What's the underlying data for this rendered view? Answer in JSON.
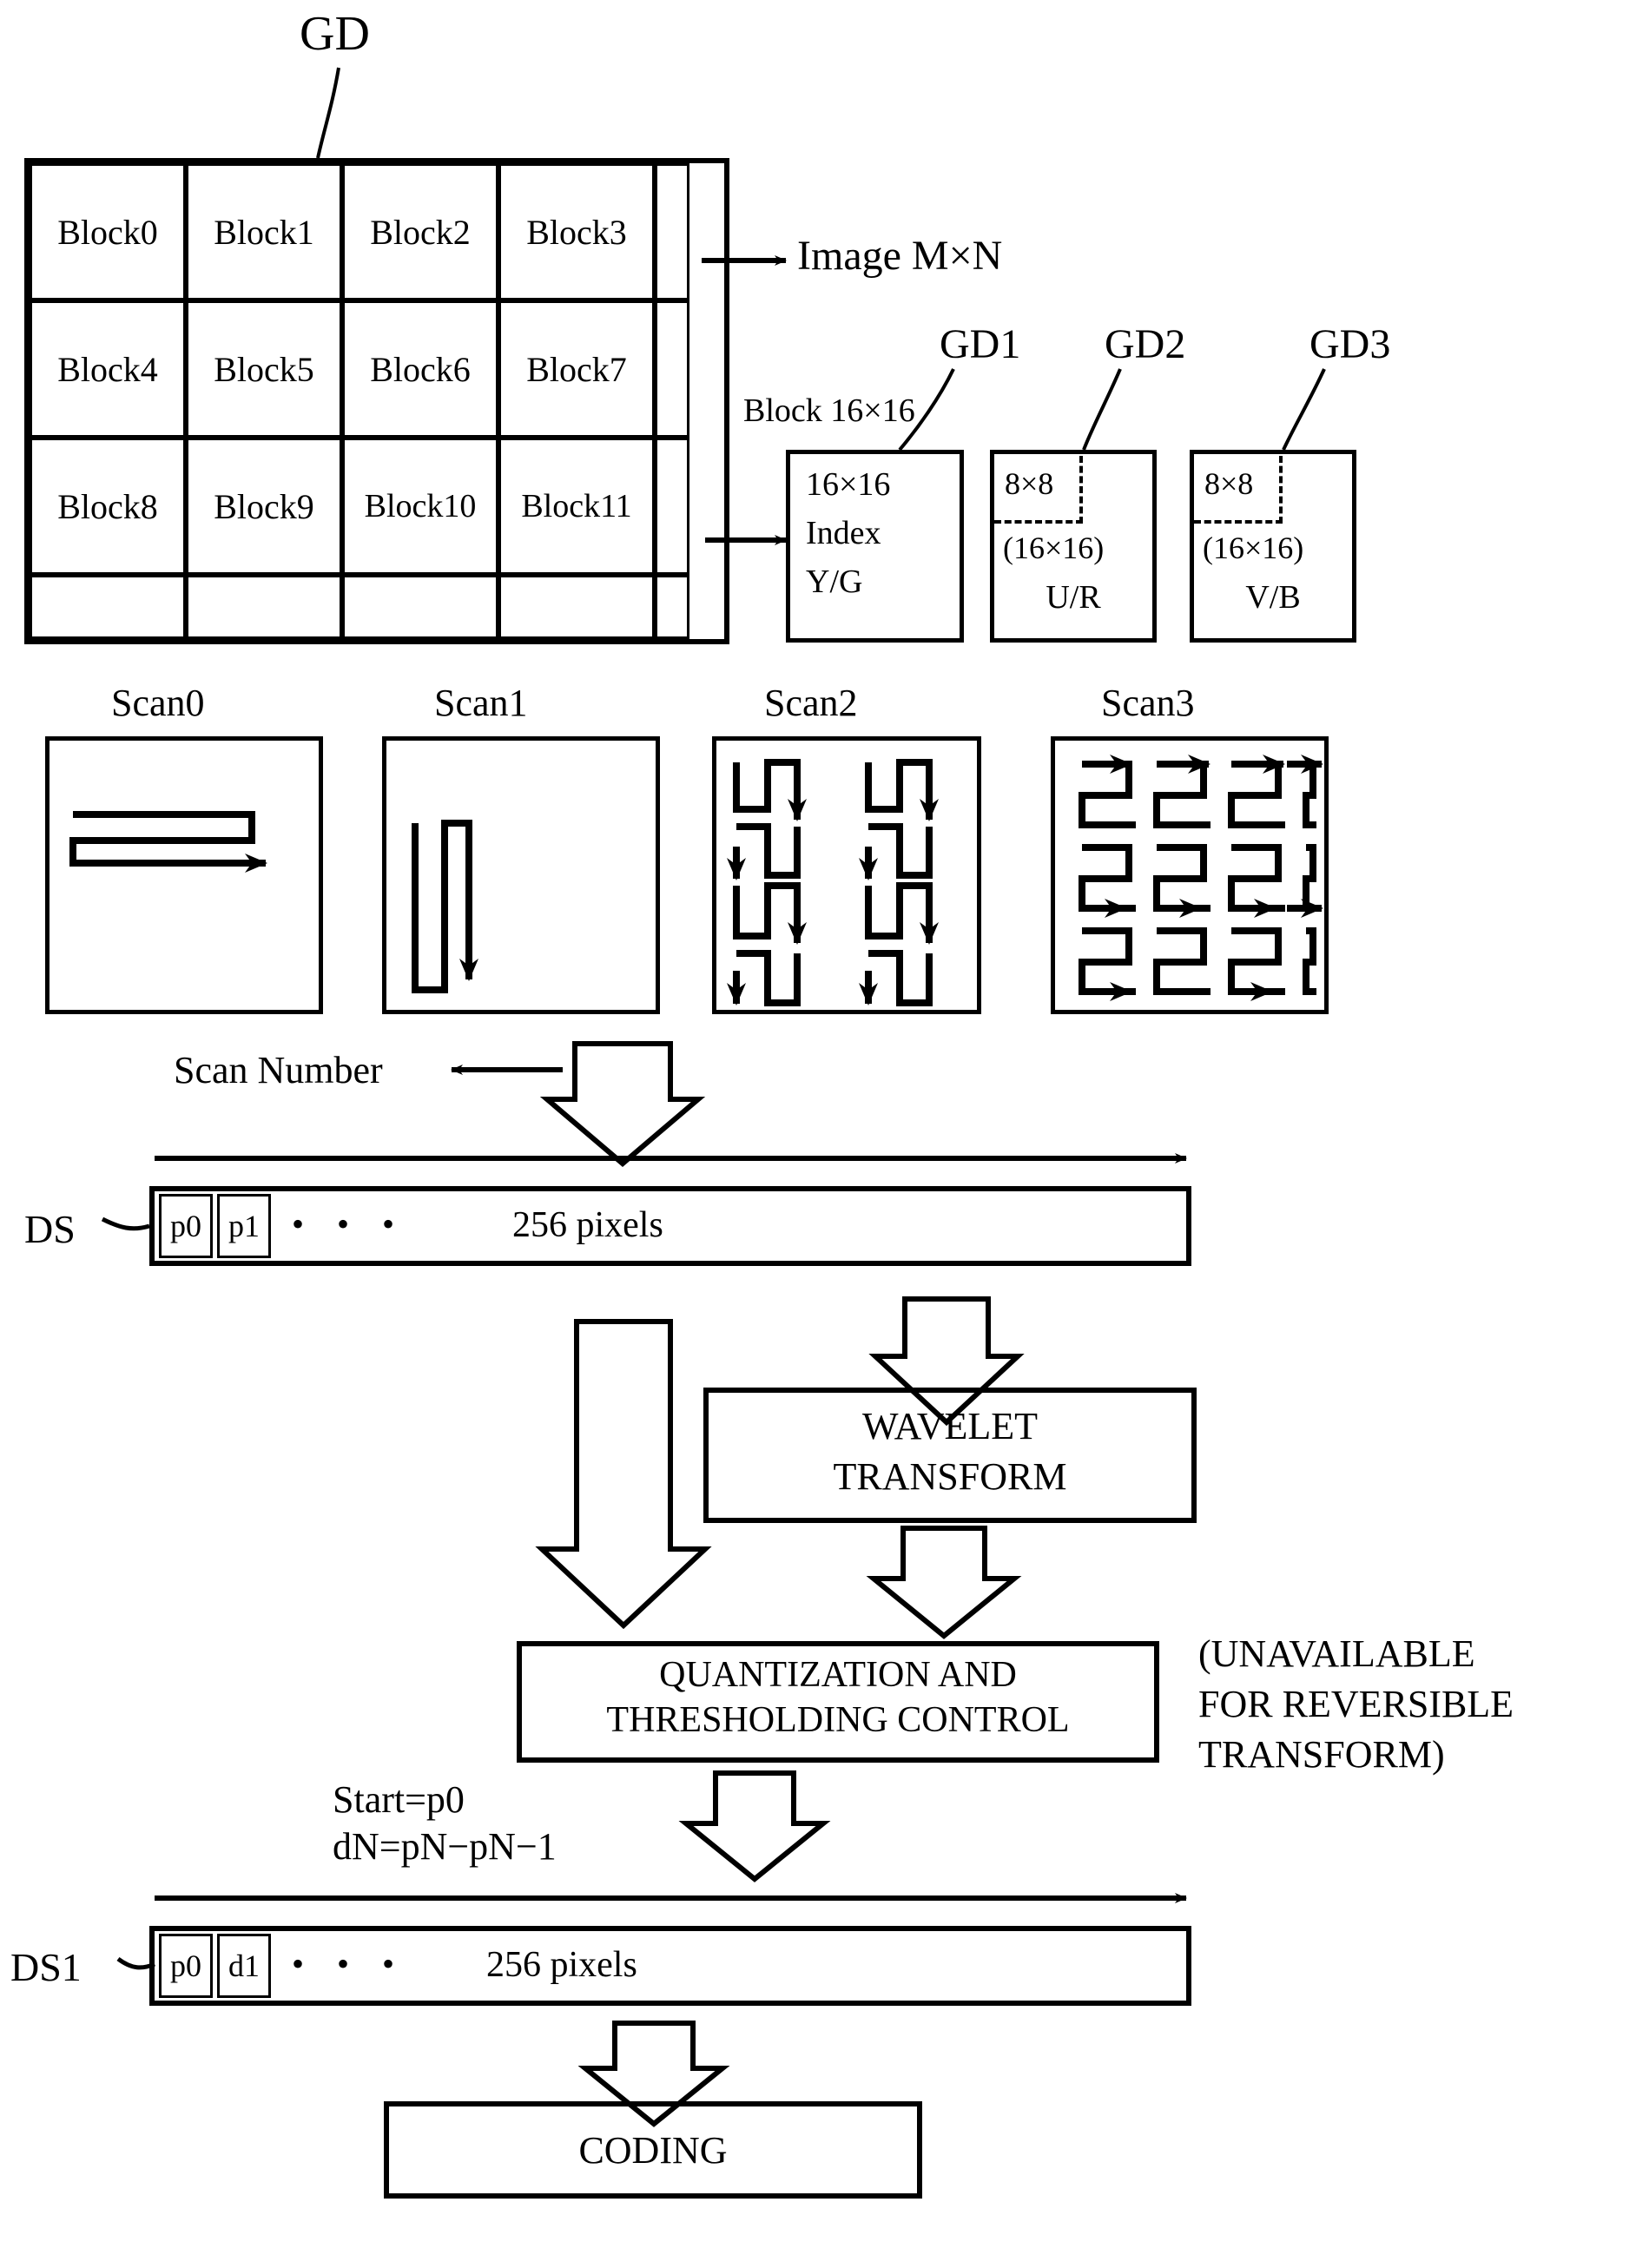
{
  "labels": {
    "gd": "GD",
    "gd1": "GD1",
    "gd2": "GD2",
    "gd3": "GD3",
    "image_mn": "Image M×N",
    "block_16x16": "Block 16×16",
    "scan_number": "Scan Number",
    "ds": "DS",
    "ds1": "DS1",
    "unavailable_note_l1": "(UNAVAILABLE",
    "unavailable_note_l2": "FOR REVERSIBLE",
    "unavailable_note_l3": "TRANSFORM)",
    "start_formula_l1": "Start=p0",
    "start_formula_l2": "dN=pN−pN−1"
  },
  "block_grid": {
    "rows": [
      [
        "Block0",
        "Block1",
        "Block2",
        "Block3"
      ],
      [
        "Block4",
        "Block5",
        "Block6",
        "Block7"
      ],
      [
        "Block8",
        "Block9",
        "Block10",
        "Block11"
      ]
    ]
  },
  "component_boxes": [
    {
      "id": "gd1",
      "line1": "16×16",
      "line2": "Index",
      "line3": "Y/G",
      "inner_label": null
    },
    {
      "id": "gd2",
      "inner_label": "8×8",
      "line2": "(16×16)",
      "line3": "U/R"
    },
    {
      "id": "gd3",
      "inner_label": "8×8",
      "line2": "(16×16)",
      "line3": "V/B"
    }
  ],
  "scans": [
    {
      "id": "scan0",
      "label": "Scan0",
      "pattern": "horizontal-raster"
    },
    {
      "id": "scan1",
      "label": "Scan1",
      "pattern": "vertical-serpentine"
    },
    {
      "id": "scan2",
      "label": "Scan2",
      "pattern": "vertical-comb-2col"
    },
    {
      "id": "scan3",
      "label": "Scan3",
      "pattern": "horizontal-comb-4col"
    }
  ],
  "ds_bar": {
    "cell0": "p0",
    "cell1": "p1",
    "dots": "•  •  •",
    "length_label": "256 pixels"
  },
  "ds1_bar": {
    "cell0": "p0",
    "cell1": "d1",
    "dots": "•  •  •",
    "length_label": "256 pixels"
  },
  "process_boxes": {
    "wavelet_l1": "WAVELET",
    "wavelet_l2": "TRANSFORM",
    "quantization_l1": "QUANTIZATION AND",
    "quantization_l2": "THRESHOLDING CONTROL",
    "coding": "CODING"
  },
  "colors": {
    "ink": "#000000",
    "paper": "#ffffff"
  }
}
